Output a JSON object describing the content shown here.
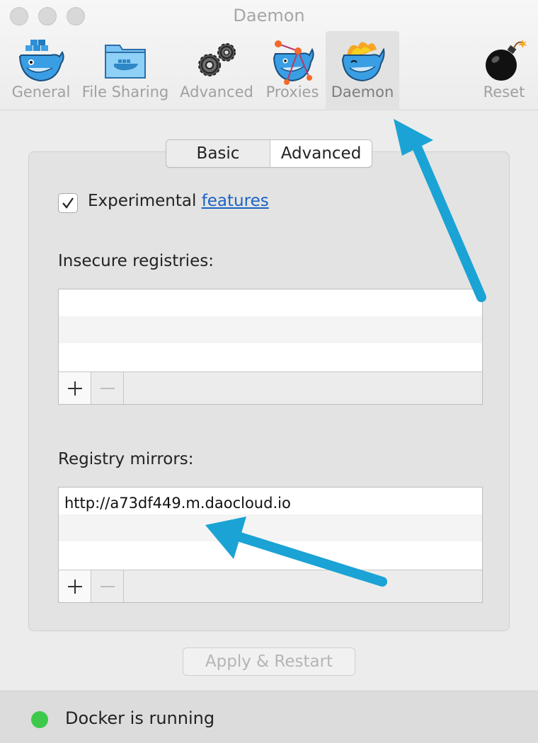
{
  "window": {
    "title": "Daemon"
  },
  "toolbar": {
    "items": [
      {
        "label": "General",
        "icon": "docker-whale-icon"
      },
      {
        "label": "File Sharing",
        "icon": "folder-whale-icon"
      },
      {
        "label": "Advanced",
        "icon": "gears-icon"
      },
      {
        "label": "Proxies",
        "icon": "proxy-whale-icon"
      },
      {
        "label": "Daemon",
        "icon": "flame-whale-icon",
        "selected": true
      },
      {
        "label": "Reset",
        "icon": "bomb-icon"
      }
    ]
  },
  "tabs": {
    "basic": "Basic",
    "advanced": "Advanced",
    "selected": "Advanced"
  },
  "experimental": {
    "checked": true,
    "label": "Experimental",
    "link": "features"
  },
  "insecure_registries": {
    "label": "Insecure registries:",
    "items": []
  },
  "registry_mirrors": {
    "label": "Registry mirrors:",
    "items": [
      "http://a73df449.m.daocloud.io"
    ]
  },
  "apply_button": {
    "label": "Apply & Restart",
    "enabled": false
  },
  "status": {
    "text": "Docker is running",
    "color": "#3ec94d"
  },
  "colors": {
    "annotation_arrow": "#1aa3d4",
    "link": "#1a63c4"
  }
}
